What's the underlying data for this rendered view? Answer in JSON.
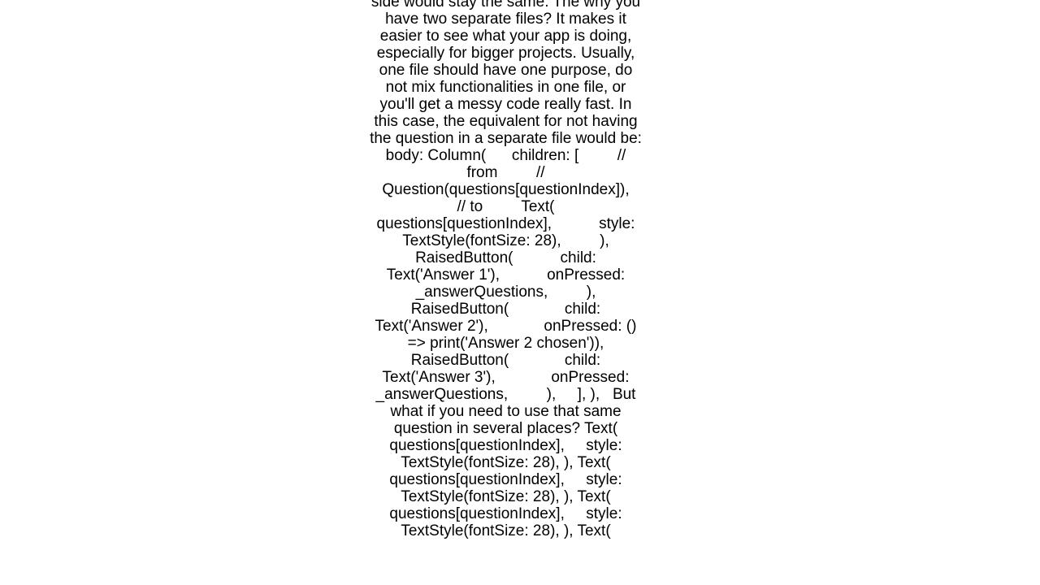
{
  "document": {
    "body_text": "side would stay the same. The why you have two separate files? It makes it easier to see what your app is doing, especially for bigger projects. Usually, one file should have one purpose, do not mix functionalities in one file, or you'll get a messy code really fast. In this case, the equivalent for not having the question in a separate file would be: body: Column(      children: [         // from         // Question(questions[questionIndex]),         // to         Text(           questions[questionIndex],           style: TextStyle(fontSize: 28),         ),         RaisedButton(           child: Text('Answer 1'),           onPressed:  _answerQuestions,         ),         RaisedButton(             child: Text('Answer 2'),             onPressed: () => print('Answer 2 chosen')),         RaisedButton(             child: Text('Answer 3'),             onPressed: _answerQuestions,         ),     ], ),   But what if you need to use that same question in several places? Text(     questions[questionIndex],     style: TextStyle(fontSize: 28), ), Text(     questions[questionIndex],     style: TextStyle(fontSize: 28), ), Text(     questions[questionIndex],     style: TextStyle(fontSize: 28), ), Text("
  }
}
